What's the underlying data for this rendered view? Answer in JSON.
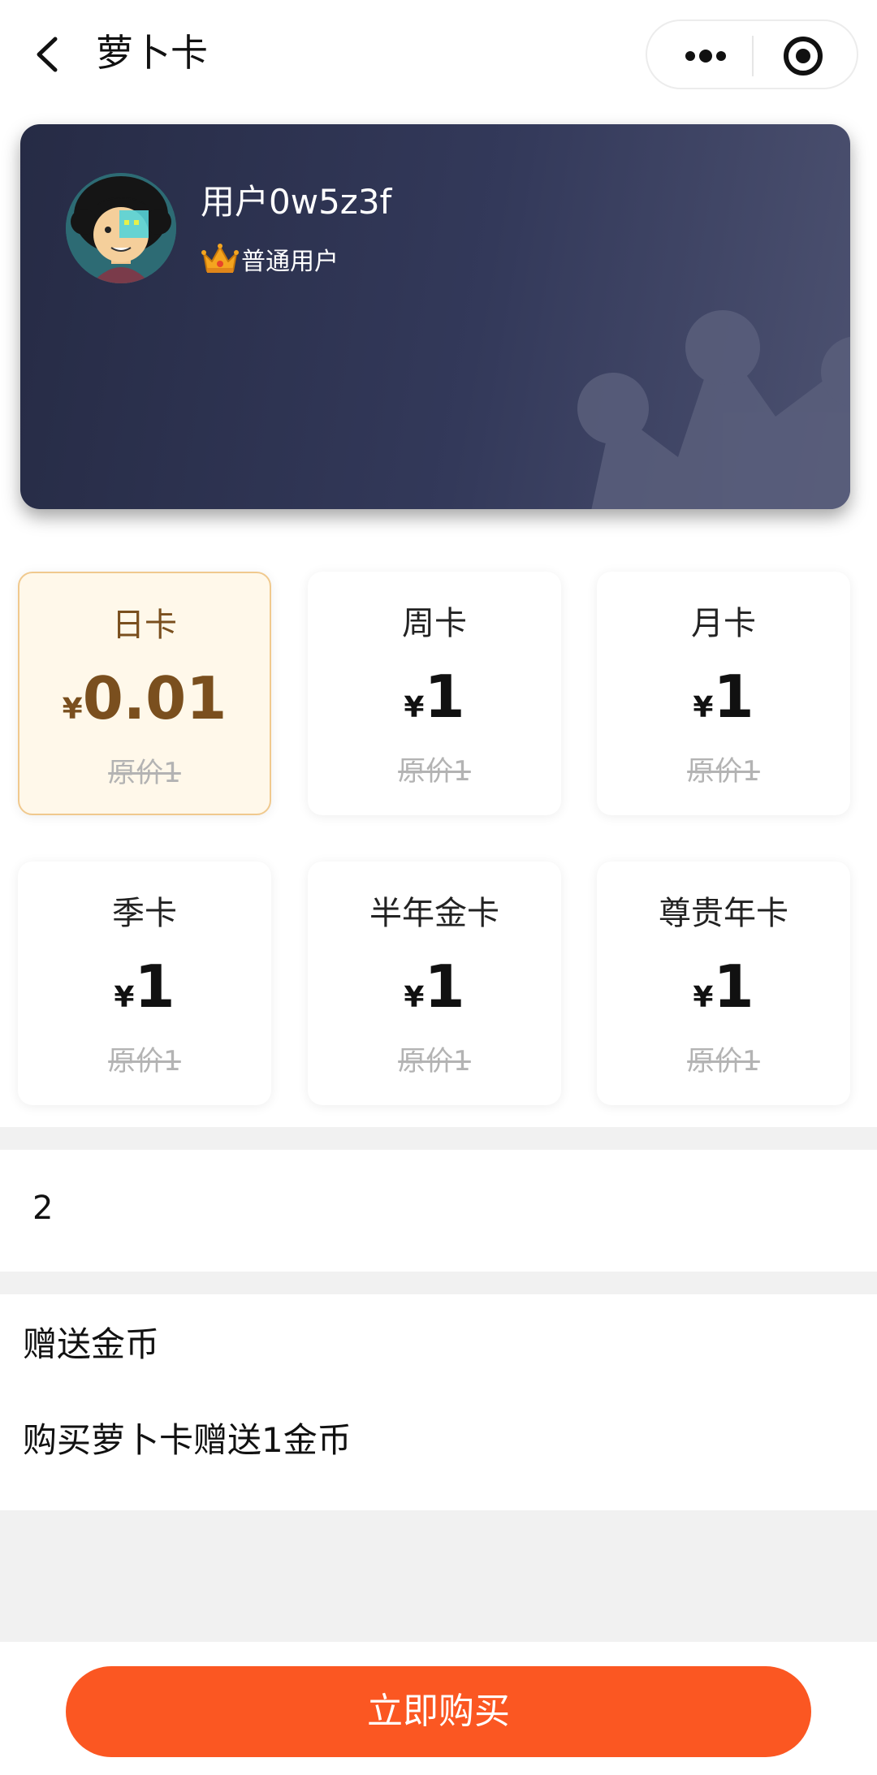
{
  "nav": {
    "title": "萝卜卡",
    "back_icon": "chevron-left-icon",
    "more_icon": "more-dots-icon",
    "target_icon": "record-target-icon"
  },
  "user": {
    "name": "用户0w5z3f",
    "level": "普通用户",
    "level_icon": "crown-icon"
  },
  "plans": [
    {
      "name": "日卡",
      "currency": "¥",
      "price": "0.01",
      "original": "原价1",
      "selected": true
    },
    {
      "name": "周卡",
      "currency": "¥",
      "price": "1",
      "original": "原价1",
      "selected": false
    },
    {
      "name": "月卡",
      "currency": "¥",
      "price": "1",
      "original": "原价1",
      "selected": false
    },
    {
      "name": "季卡",
      "currency": "¥",
      "price": "1",
      "original": "原价1",
      "selected": false
    },
    {
      "name": "半年金卡",
      "currency": "¥",
      "price": "1",
      "original": "原价1",
      "selected": false
    },
    {
      "name": "尊贵年卡",
      "currency": "¥",
      "price": "1",
      "original": "原价1",
      "selected": false
    }
  ],
  "quantity": {
    "value": "2"
  },
  "gift": {
    "title": "赠送金币",
    "description": "购买萝卜卡赠送1金币"
  },
  "buy_button": {
    "label": "立即购买"
  },
  "colors": {
    "accent": "#fb5722",
    "card_bg": "#2f3452",
    "selected_bg": "#fff8ea",
    "selected_border": "#f0c98e"
  }
}
